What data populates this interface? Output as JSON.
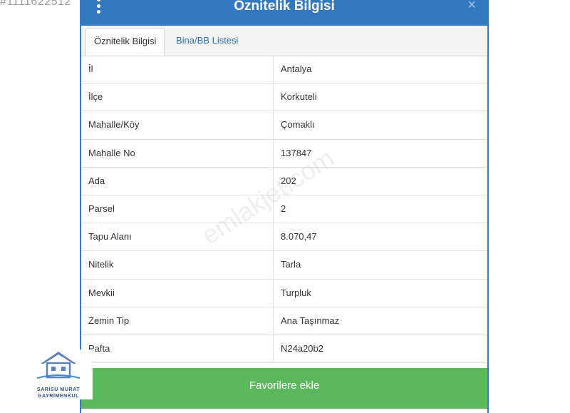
{
  "corner_id": "#1111622512",
  "window": {
    "title": "Öznitelik Bilgisi",
    "close_symbol": "×"
  },
  "tabs": [
    {
      "label": "Öznitelik Bilgisi",
      "active": true
    },
    {
      "label": "Bina/BB Listesi",
      "active": false
    }
  ],
  "rows": [
    {
      "key": "İl",
      "value": "Antalya"
    },
    {
      "key": "İlçe",
      "value": "Korkuteli"
    },
    {
      "key": "Mahalle/Köy",
      "value": "Çomaklı"
    },
    {
      "key": "Mahalle No",
      "value": "137847"
    },
    {
      "key": "Ada",
      "value": "202"
    },
    {
      "key": "Parsel",
      "value": "2"
    },
    {
      "key": "Tapu Alanı",
      "value": "8.070,47"
    },
    {
      "key": "Nitelik",
      "value": "Tarla"
    },
    {
      "key": "Mevkii",
      "value": "Turpluk"
    },
    {
      "key": "Zemin Tip",
      "value": "Ana Taşınmaz"
    },
    {
      "key": "Pafta",
      "value": "N24a20b2"
    }
  ],
  "favorite_button": "Favorilere ekle",
  "watermark": "emlakjet.com",
  "logo": {
    "line1": "SARISU MURAT",
    "line2": "GAYRİMENKUL"
  },
  "colors": {
    "header": "#3379c0",
    "favorite": "#5cb85c",
    "tab_link": "#2f6fb0"
  },
  "icons": {
    "menu": "kebab-menu-icon",
    "close": "close-icon",
    "logo": "house-logo-icon"
  }
}
